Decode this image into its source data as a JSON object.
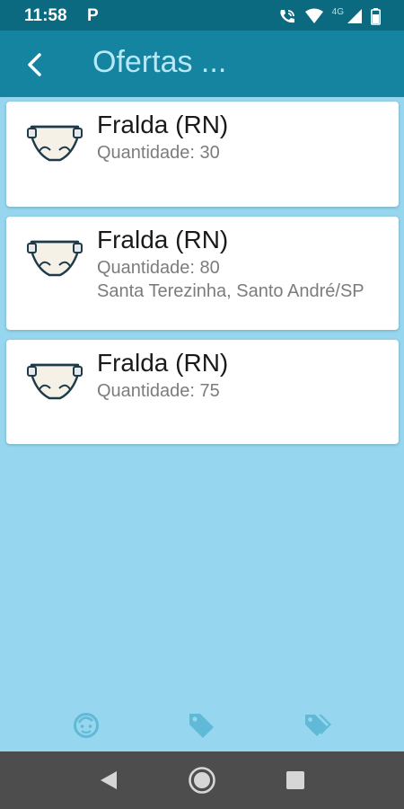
{
  "status_bar": {
    "time": "11:58",
    "notification": "P",
    "network": "4G"
  },
  "app_bar": {
    "title": "Ofertas ..."
  },
  "offers": [
    {
      "title": "Fralda (RN)",
      "quantity": "Quantidade: 30",
      "location": ""
    },
    {
      "title": "Fralda (RN)",
      "quantity": "Quantidade: 80",
      "location": "Santa Terezinha, Santo André/SP"
    },
    {
      "title": "Fralda (RN)",
      "quantity": "Quantidade: 75",
      "location": ""
    }
  ],
  "bottom_nav": [
    "baby-face-icon",
    "tag-icon",
    "tags-icon"
  ],
  "colors": {
    "status_bar": "#0b6a80",
    "app_bar": "#1584a0",
    "background": "#96d6ee",
    "nav_icon": "#5fb9d7",
    "system_nav": "#4d4d4d"
  }
}
